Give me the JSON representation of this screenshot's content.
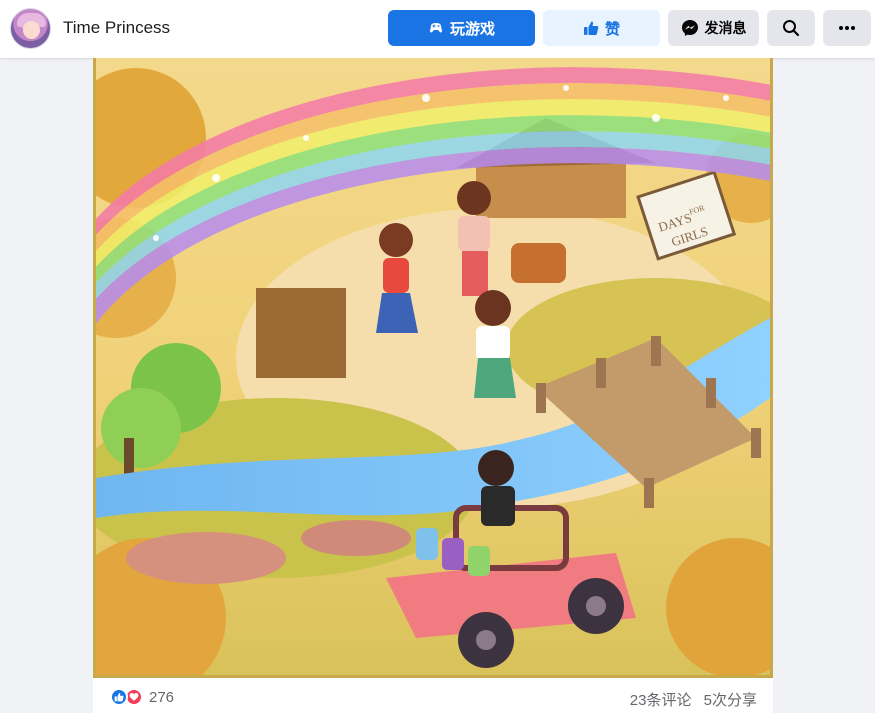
{
  "header": {
    "page_name": "Time Princess",
    "play_label": "玩游戏",
    "like_label": "赞",
    "message_label": "发消息"
  },
  "image": {
    "sign_text_1": "DAYS",
    "sign_text_2": "FOR",
    "sign_text_3": "GIRLS"
  },
  "footer": {
    "reaction_count": "276",
    "comments": "23条评论",
    "shares": "5次分享"
  },
  "colors": {
    "primary": "#1b74e4",
    "like_bg": "#e7f3ff",
    "secondary_bg": "#e4e6eb",
    "love": "#f33e58"
  }
}
